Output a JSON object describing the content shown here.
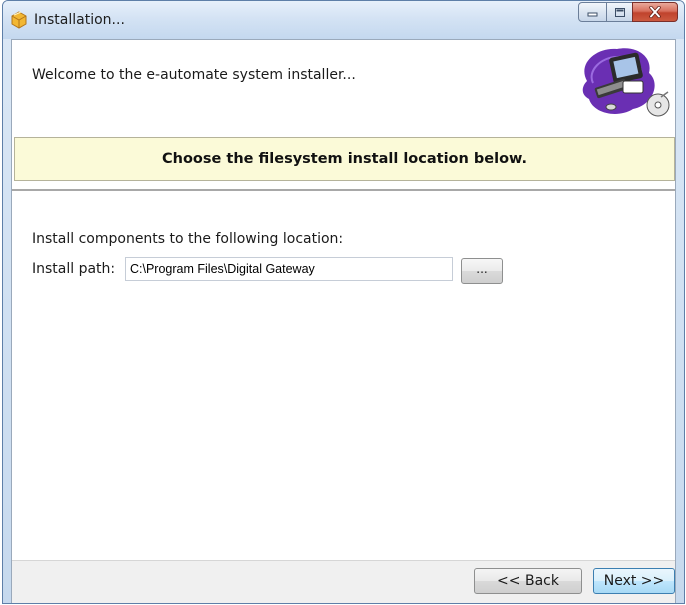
{
  "window": {
    "title": "Installation...",
    "caption_buttons": [
      "minimize",
      "maximize",
      "close"
    ]
  },
  "header": {
    "welcome": "Welcome to the e-automate system installer..."
  },
  "banner": {
    "text": "Choose the filesystem install location below."
  },
  "content": {
    "install_label": "Install components to the following location:",
    "path_label": "Install path:",
    "path_value": "C:\\Program Files\\Digital Gateway",
    "browse_label": "..."
  },
  "footer": {
    "back_label": "<< Back",
    "next_label": "Next >>"
  },
  "colors": {
    "banner_bg": "#fbfad8",
    "close_button": "#c0432d",
    "next_button_border": "#3c7fb1"
  }
}
